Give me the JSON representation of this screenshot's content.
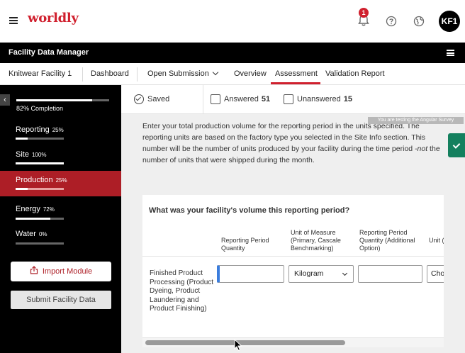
{
  "header": {
    "logo": "worldly",
    "notification_count": "1",
    "avatar_initials": "KF1"
  },
  "appbar": {
    "title": "Facility Data Manager"
  },
  "subnav": {
    "facility": "Knitwear Facility 1",
    "dashboard": "Dashboard",
    "submission": "Open Submission",
    "tabs": [
      {
        "label": "Overview"
      },
      {
        "label": "Assessment",
        "active": true
      },
      {
        "label": "Validation Report"
      }
    ]
  },
  "sidebar": {
    "completion_label": "82% Completion",
    "completion_fraction": 0.82,
    "sections": [
      {
        "name": "Reporting",
        "pct": "25%",
        "fraction": 0.25
      },
      {
        "name": "Site",
        "pct": "100%",
        "fraction": 1.0
      },
      {
        "name": "Production",
        "pct": "25%",
        "fraction": 0.25,
        "active": true
      },
      {
        "name": "Energy",
        "pct": "72%",
        "fraction": 0.72
      },
      {
        "name": "Water",
        "pct": "0%",
        "fraction": 0.0
      }
    ],
    "import_label": "Import Module",
    "submit_label": "Submit Facility Data"
  },
  "status": {
    "saved": "Saved",
    "answered_label": "Answered",
    "answered_count": "51",
    "unanswered_label": "Unanswered",
    "unanswered_count": "15"
  },
  "testing_badge": "You are testing the Angular Survey",
  "intro": {
    "text": "Enter your total production volume for the reporting period in the units specified. The reporting units are based on the factory type you selected in the Site Info section. This number will be the number of units produced by your facility during the time period ",
    "emphasis": "-not",
    "text_end": " the number of units that were shipped during the month."
  },
  "question": {
    "title": "What was your facility's volume this reporting period?",
    "columns": [
      "Reporting Period Quantity",
      "Unit of Measure (Primary, Cascale Benchmarking)",
      "Reporting Period Quantity (Additional Option)",
      "Unit (Add"
    ],
    "row_label": "Finished Product Processing (Product Dyeing, Product Laundering and Product Finishing)",
    "quantity_value": "",
    "unit_value": "Kilogram",
    "additional_quantity_value": "",
    "additional_unit_value": "Cho"
  },
  "colors": {
    "brand_red": "#d0202e",
    "sidebar_active": "#ad1e26",
    "confirm_green": "#14805e",
    "focus_blue": "#3b7ddd"
  },
  "icons": [
    "hamburger-icon",
    "bell-icon",
    "help-icon",
    "globe-icon",
    "menu-icon",
    "collapse-icon",
    "check-circle-icon",
    "upload-icon",
    "checkmark-icon",
    "chevron-down-icon",
    "pointer-cursor"
  ]
}
